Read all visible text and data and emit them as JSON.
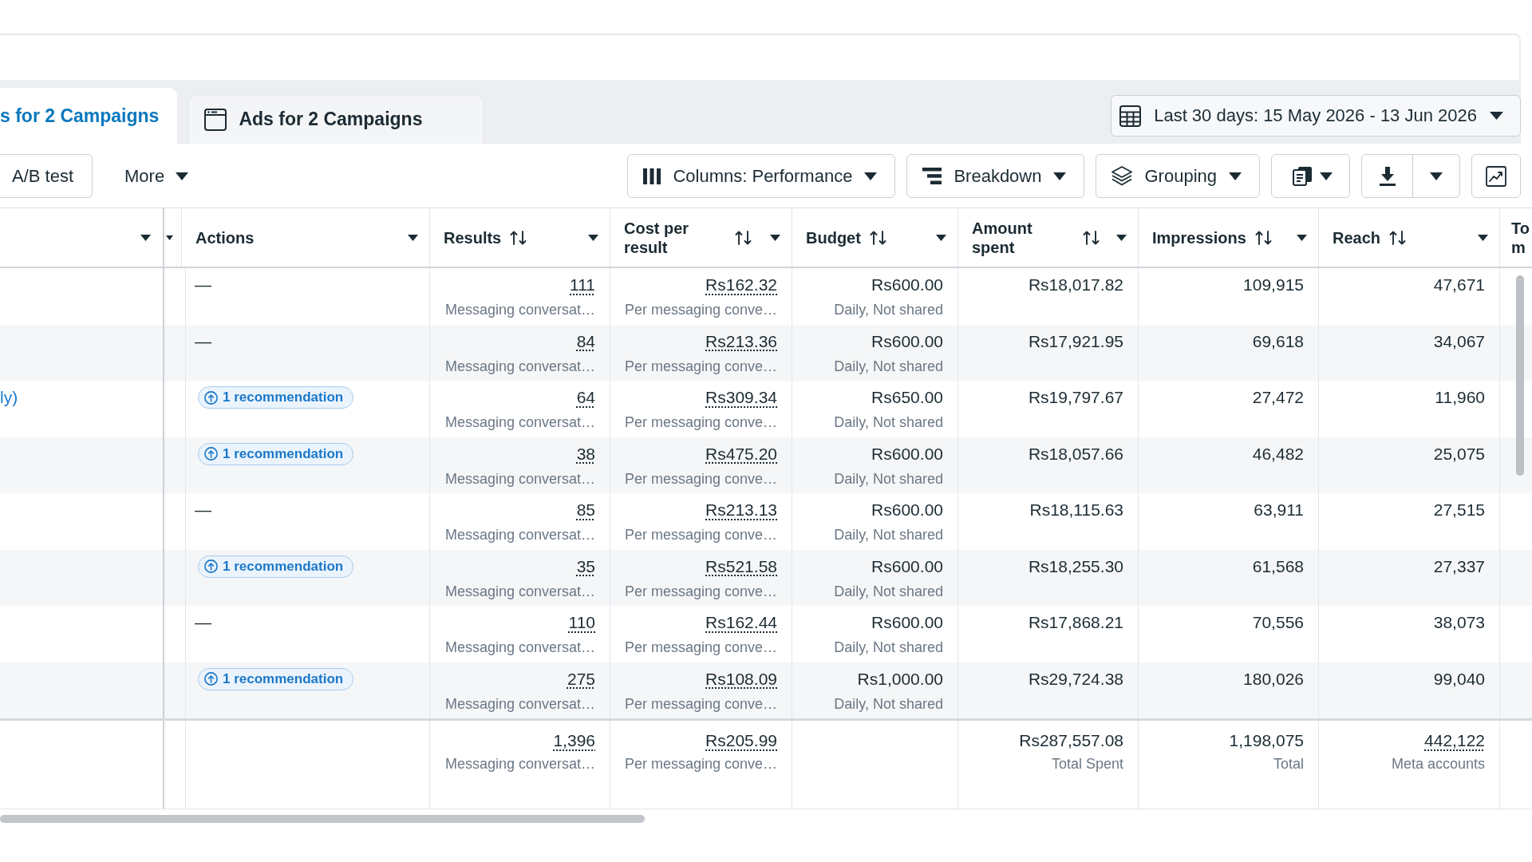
{
  "tabs": [
    {
      "label": "s for 2 Campaigns",
      "selected": true
    },
    {
      "label": "Ads for 2 Campaigns",
      "selected": false
    }
  ],
  "date_range": {
    "label": "Last 30 days: 15 May 2026 - 13 Jun 2026"
  },
  "toolbar": {
    "left": [
      {
        "kind": "button",
        "label": "A/B test"
      },
      {
        "kind": "menu",
        "label": "More"
      }
    ],
    "right": [
      {
        "kind": "dropdown",
        "label": "Columns: Performance"
      },
      {
        "kind": "dropdown",
        "label": "Breakdown"
      },
      {
        "kind": "dropdown",
        "label": "Grouping"
      },
      {
        "kind": "icon-dropdown"
      },
      {
        "kind": "split"
      },
      {
        "kind": "icon"
      }
    ]
  },
  "table": {
    "columns": [
      {
        "sortable": false,
        "menu": true
      },
      {
        "sortable": false,
        "menu": true
      },
      {
        "label": "Actions",
        "sortable": false,
        "menu": true
      },
      {
        "label": "Results",
        "sortable": true,
        "menu": true
      },
      {
        "label": "Cost per result",
        "sortable": true,
        "menu": true
      },
      {
        "label": "Budget",
        "sortable": true,
        "menu": true
      },
      {
        "label": "Amount spent",
        "sortable": true,
        "menu": true
      },
      {
        "label": "Impressions",
        "sortable": true,
        "menu": true
      },
      {
        "label": "Reach",
        "sortable": true,
        "menu": true
      },
      {
        "label": "To m"
      }
    ],
    "rows": [
      {
        "actions": {
          "kind": "none",
          "text": "—"
        },
        "results": {
          "value": "111",
          "detail": "Messaging conversat…"
        },
        "cost_per_result": {
          "value": "Rs162.32",
          "detail": "Per messaging conve…"
        },
        "budget": {
          "value": "Rs600.00",
          "detail": "Daily, Not shared"
        },
        "amount_spent": {
          "value": "Rs18,017.82"
        },
        "impressions": {
          "value": "109,915"
        },
        "reach": {
          "value": "47,671"
        }
      },
      {
        "actions": {
          "kind": "none",
          "text": "—"
        },
        "results": {
          "value": "84",
          "detail": "Messaging conversat…"
        },
        "cost_per_result": {
          "value": "Rs213.36",
          "detail": "Per messaging conve…"
        },
        "budget": {
          "value": "Rs600.00",
          "detail": "Daily, Not shared"
        },
        "amount_spent": {
          "value": "Rs17,921.95"
        },
        "impressions": {
          "value": "69,618"
        },
        "reach": {
          "value": "34,067"
        }
      },
      {
        "column_1": "ly)",
        "actions": {
          "kind": "recommendation",
          "text": "1 recommendation"
        },
        "results": {
          "value": "64",
          "detail": "Messaging conversat…"
        },
        "cost_per_result": {
          "value": "Rs309.34",
          "detail": "Per messaging conve…"
        },
        "budget": {
          "value": "Rs650.00",
          "detail": "Daily, Not shared"
        },
        "amount_spent": {
          "value": "Rs19,797.67"
        },
        "impressions": {
          "value": "27,472"
        },
        "reach": {
          "value": "11,960"
        }
      },
      {
        "actions": {
          "kind": "recommendation",
          "text": "1 recommendation"
        },
        "results": {
          "value": "38",
          "detail": "Messaging conversat…"
        },
        "cost_per_result": {
          "value": "Rs475.20",
          "detail": "Per messaging conve…"
        },
        "budget": {
          "value": "Rs600.00",
          "detail": "Daily, Not shared"
        },
        "amount_spent": {
          "value": "Rs18,057.66"
        },
        "impressions": {
          "value": "46,482"
        },
        "reach": {
          "value": "25,075"
        }
      },
      {
        "actions": {
          "kind": "none",
          "text": "—"
        },
        "results": {
          "value": "85",
          "detail": "Messaging conversat…"
        },
        "cost_per_result": {
          "value": "Rs213.13",
          "detail": "Per messaging conve…"
        },
        "budget": {
          "value": "Rs600.00",
          "detail": "Daily, Not shared"
        },
        "amount_spent": {
          "value": "Rs18,115.63"
        },
        "impressions": {
          "value": "63,911"
        },
        "reach": {
          "value": "27,515"
        }
      },
      {
        "actions": {
          "kind": "recommendation",
          "text": "1 recommendation"
        },
        "results": {
          "value": "35",
          "detail": "Messaging conversat…"
        },
        "cost_per_result": {
          "value": "Rs521.58",
          "detail": "Per messaging conve…"
        },
        "budget": {
          "value": "Rs600.00",
          "detail": "Daily, Not shared"
        },
        "amount_spent": {
          "value": "Rs18,255.30"
        },
        "impressions": {
          "value": "61,568"
        },
        "reach": {
          "value": "27,337"
        }
      },
      {
        "actions": {
          "kind": "none",
          "text": "—"
        },
        "results": {
          "value": "110",
          "detail": "Messaging conversat…"
        },
        "cost_per_result": {
          "value": "Rs162.44",
          "detail": "Per messaging conve…"
        },
        "budget": {
          "value": "Rs600.00",
          "detail": "Daily, Not shared"
        },
        "amount_spent": {
          "value": "Rs17,868.21"
        },
        "impressions": {
          "value": "70,556"
        },
        "reach": {
          "value": "38,073"
        }
      },
      {
        "actions": {
          "kind": "recommendation",
          "text": "1 recommendation"
        },
        "results": {
          "value": "275",
          "detail": "Messaging conversat…"
        },
        "cost_per_result": {
          "value": "Rs108.09",
          "detail": "Per messaging conve…"
        },
        "budget": {
          "value": "Rs1,000.00",
          "detail": "Daily, Not shared"
        },
        "amount_spent": {
          "value": "Rs29,724.38"
        },
        "impressions": {
          "value": "180,026"
        },
        "reach": {
          "value": "99,040"
        }
      }
    ],
    "totals": {
      "results": {
        "value": "1,396",
        "detail": "Messaging conversat…"
      },
      "cost_per_result": {
        "value": "Rs205.99",
        "detail": "Per messaging conve…"
      },
      "amount_spent": {
        "value": "Rs287,557.08",
        "detail": "Total Spent"
      },
      "impressions": {
        "value": "1,198,075",
        "detail": "Total"
      },
      "reach": {
        "value": "442,122",
        "detail": "Meta accounts"
      }
    }
  }
}
